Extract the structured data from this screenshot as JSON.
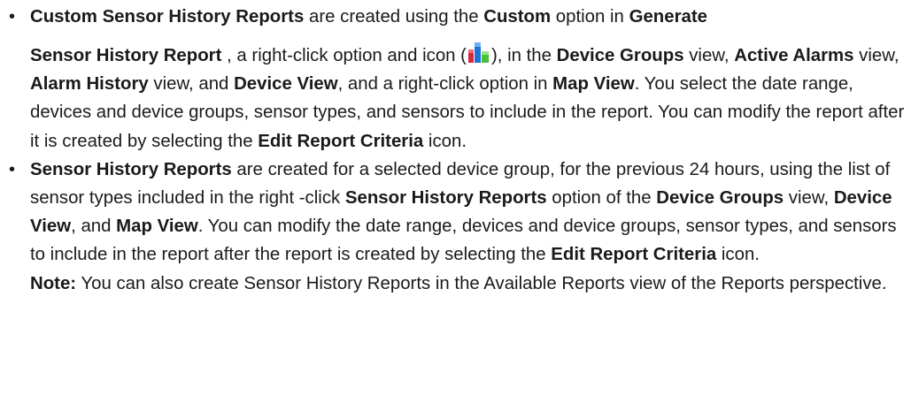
{
  "items": [
    {
      "bullet": "•",
      "seg": [
        "Custom Sensor History Reports",
        " are created using the ",
        "Custom",
        " option in ",
        "Generate Sensor History Report",
        " , a right-click option and icon (",
        "), in the ",
        "Device Groups",
        " view, ",
        "Active Alarms",
        " view, ",
        "Alarm History",
        " view, and ",
        "Device View",
        ", and a right-click option in ",
        "Map View",
        ". You select the date range, devices and device groups, sensor types, and sensors to include in the report. You can modify the report after it is created by selecting the ",
        "Edit Report Criteria",
        " icon."
      ]
    },
    {
      "bullet": "•",
      "seg": [
        "Sensor History Reports",
        " are created for a selected device group, for the previous 24 hours, using the list of sensor types included in the right -click ",
        "Sensor History Reports",
        " option of the ",
        "Device Groups",
        " view, ",
        "Device View",
        ", and ",
        "Map View",
        ". You can modify the date range, devices and device groups, sensor types, and sensors to include in the report after the report is created by selecting the ",
        "Edit Report Criteria",
        " icon."
      ],
      "note_label": "Note:",
      "note_text": " You can also create Sensor History Reports in the Available Reports view of the Reports perspective."
    }
  ],
  "icons": {
    "report_icon": "sensor-history-report-icon"
  },
  "colors": {
    "text": "#1a1a1a",
    "bar_red": "#d9263c",
    "bar_blue": "#1e73d6",
    "bar_green": "#4cbf3a"
  }
}
